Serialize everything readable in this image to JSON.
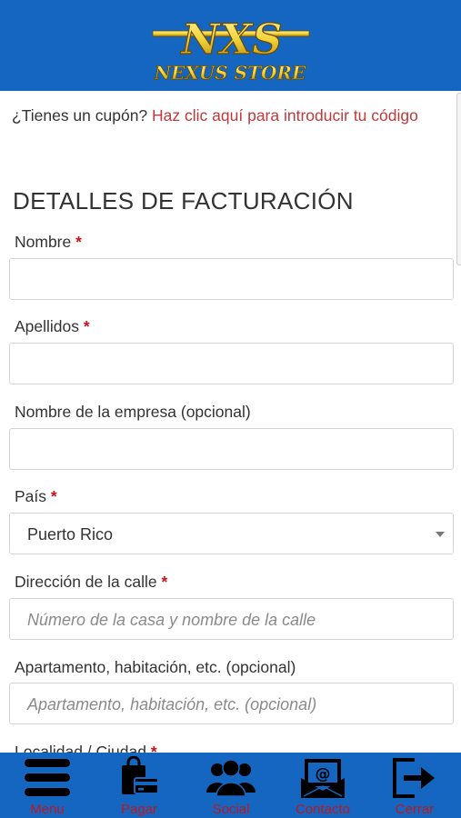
{
  "header": {
    "logo_text": "NXS",
    "logo_subtitle": "NEXUS STORE"
  },
  "coupon": {
    "question": "¿Tienes un cupón?",
    "link": "Haz clic aquí para introducir tu código"
  },
  "billing": {
    "title": "DETALLES DE FACTURACIÓN",
    "required_mark": "*",
    "fields": {
      "first_name": {
        "label": "Nombre",
        "value": ""
      },
      "last_name": {
        "label": "Apellidos",
        "value": ""
      },
      "company": {
        "label": "Nombre de la empresa (opcional)",
        "value": ""
      },
      "country": {
        "label": "País",
        "value": "Puerto Rico"
      },
      "street": {
        "label": "Dirección de la calle",
        "placeholder": "Número de la casa y nombre de la calle"
      },
      "apartment": {
        "label": "Apartamento, habitación, etc. (opcional)",
        "placeholder": "Apartamento, habitación, etc. (opcional)"
      },
      "city": {
        "label": "Localidad / Ciudad"
      }
    }
  },
  "bottom_nav": {
    "items": [
      {
        "label": "Menu",
        "icon": "hamburger-icon"
      },
      {
        "label": "Pagar",
        "icon": "shopping-bag-card-icon"
      },
      {
        "label": "Social",
        "icon": "users-group-icon"
      },
      {
        "label": "Contacto",
        "icon": "envelope-at-icon"
      },
      {
        "label": "Cerrar",
        "icon": "sign-out-icon"
      }
    ]
  },
  "colors": {
    "brand_blue": "#1566c0",
    "link_red": "#c0393b",
    "required_red": "#c0171d",
    "logo_gold": "#f2d43b"
  }
}
